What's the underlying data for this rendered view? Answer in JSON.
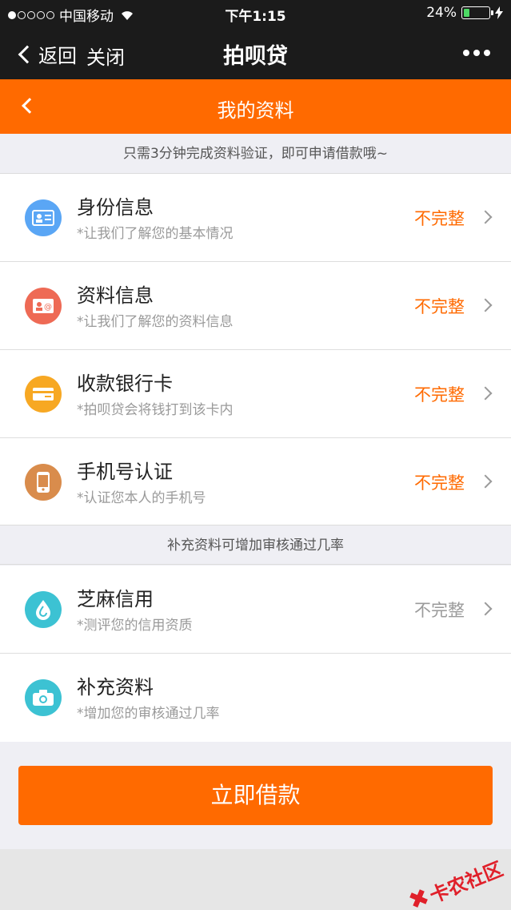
{
  "status_bar": {
    "carrier": "中国移动",
    "time": "下午1:15",
    "battery": "24%",
    "signal_bars": 1,
    "battery_level": 0.24
  },
  "nav": {
    "back_label": "返回",
    "close_label": "关闭",
    "title": "拍呗贷"
  },
  "subheader": {
    "title": "我的资料"
  },
  "banner1": "只需3分钟完成资料验证，即可申请借款哦~",
  "section1": [
    {
      "title": "身份信息",
      "subtitle": "*让我们了解您的基本情况",
      "status": "不完整",
      "icon": "id-card-icon",
      "color": "#5aa6f5"
    },
    {
      "title": "资料信息",
      "subtitle": "*让我们了解您的资料信息",
      "status": "不完整",
      "icon": "contact-card-icon",
      "color": "#ee6a55"
    },
    {
      "title": "收款银行卡",
      "subtitle": "*拍呗贷会将钱打到该卡内",
      "status": "不完整",
      "icon": "bank-card-icon",
      "color": "#f7a823"
    },
    {
      "title": "手机号认证",
      "subtitle": "*认证您本人的手机号",
      "status": "不完整",
      "icon": "phone-icon",
      "color": "#d98c4c"
    }
  ],
  "banner2": "补充资料可增加审核通过几率",
  "section2": [
    {
      "title": "芝麻信用",
      "subtitle": "*测评您的信用资质",
      "status": "不完整",
      "icon": "sesame-credit-icon",
      "color": "#3cc2d3"
    },
    {
      "title": "补充资料",
      "subtitle": "*增加您的审核通过几率",
      "status": "",
      "icon": "camera-icon",
      "color": "#3cc2d3"
    }
  ],
  "button": "立即借款",
  "watermark": "卡农社区",
  "colors": {
    "accent": "#ff6a00",
    "status_warn": "#ff6a00",
    "status_muted": "#9a9a9a"
  }
}
